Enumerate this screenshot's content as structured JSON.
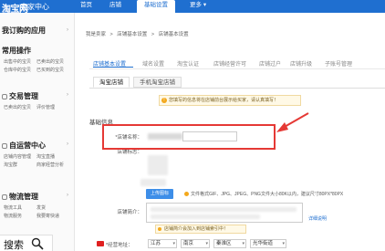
{
  "topbar": {
    "logo": "淘宝网",
    "logo_sub": "卖家中心",
    "logo_url": "Taobao.com",
    "nav": [
      "首页",
      "店铺",
      "基础设置",
      "更多"
    ],
    "active_nav_index": 2,
    "accent": "#1f6fd0"
  },
  "sidebar": {
    "heading": "我订购的应用",
    "sections": [
      {
        "title": "常用操作",
        "items": [
          "出售中的宝贝",
          "已卖出的宝贝",
          "仓库中的宝贝",
          "已买到的宝贝"
        ]
      },
      {
        "title": "交易管理",
        "items": [
          "已卖出的宝贝",
          "评价管理"
        ]
      },
      {
        "title": "自运营中心",
        "items": [
          "店铺内容管理",
          "淘宝直播",
          "淘宝群",
          "商家经营分析"
        ]
      },
      {
        "title": "物流管理",
        "items": [
          "物流工具",
          "发货",
          "物流服务",
          "我要寄快递"
        ]
      }
    ]
  },
  "breadcrumb": [
    "我是卖家",
    ">",
    "店铺基本设置",
    ">",
    "店铺基本设置"
  ],
  "tabs_primary": [
    "店铺基本设置",
    "域名设置",
    "淘宝认证",
    "店铺经营许可",
    "店铺过户",
    "店铺升级",
    "子账号管理"
  ],
  "tabs_primary_active": 0,
  "tabs_secondary": [
    "淘宝店铺",
    "手机淘宝店铺"
  ],
  "tabs_secondary_active": 0,
  "notice": "您填写的信息将在店铺前台展示给买家，请认真填写！",
  "section_title": "基础信息",
  "form": {
    "store_name_label": "*店铺名称：",
    "store_logo_label": "店铺标志：",
    "upload_button": "上传图标",
    "upload_tip": "文件格式GIF、JPG、JPEG、PNG文件大小80K以内，建议尺寸80PX*80PX",
    "store_intro_label": "店铺简介：",
    "detail_link": "详细说明",
    "intro_tip": "店铺简介会加入到店铺索引中！",
    "address_label": "*经营地址：",
    "address_selects": [
      "江苏",
      "南京",
      "秦淮区",
      "光华街道"
    ]
  },
  "overlay": {
    "search_label": "搜索"
  }
}
